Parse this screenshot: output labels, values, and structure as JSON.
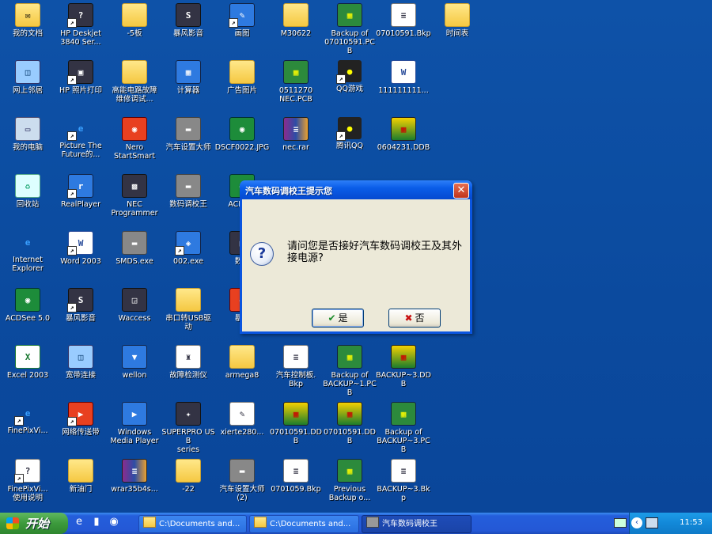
{
  "desktop": {
    "icons": [
      {
        "label": "我的文档",
        "type": "folder",
        "glyph": "✉"
      },
      {
        "label": "HP Deskjet\n3840 Ser...",
        "type": "app",
        "glyph": "?",
        "shortcut": true
      },
      {
        "label": "-5板",
        "type": "folder",
        "glyph": ""
      },
      {
        "label": "暴风影音",
        "type": "app",
        "glyph": "S"
      },
      {
        "label": "画图",
        "type": "blue",
        "glyph": "✎",
        "shortcut": true
      },
      {
        "label": "M30622",
        "type": "folder",
        "glyph": ""
      },
      {
        "label": "Backup of\n07010591.PCB",
        "type": "pcb",
        "glyph": "▦"
      },
      {
        "label": "07010591.Bkp",
        "type": "doc",
        "glyph": "≡"
      },
      {
        "label": "时间表",
        "type": "folder",
        "glyph": ""
      },
      {
        "label": "网上邻居",
        "type": "net",
        "glyph": "◫"
      },
      {
        "label": "HP 照片打印",
        "type": "app",
        "glyph": "▣",
        "shortcut": true
      },
      {
        "label": "高能电路故障\n维修调试...",
        "type": "folder",
        "glyph": ""
      },
      {
        "label": "计算器",
        "type": "blue",
        "glyph": "▦"
      },
      {
        "label": "广告图片",
        "type": "folder",
        "glyph": ""
      },
      {
        "label": "0511270\nNEC.PCB",
        "type": "pcb",
        "glyph": "▦"
      },
      {
        "label": "QQ游戏",
        "type": "qq",
        "glyph": "●",
        "shortcut": true
      },
      {
        "label": "111111111...",
        "type": "word",
        "glyph": "W"
      },
      {
        "label": "我的电脑",
        "type": "pc",
        "glyph": "▭"
      },
      {
        "label": "Picture The\nFuture的...",
        "type": "ie",
        "glyph": "e",
        "shortcut": true
      },
      {
        "label": "Nero\nStartSmart",
        "type": "red",
        "glyph": "◉"
      },
      {
        "label": "汽车设置大师",
        "type": "chip",
        "glyph": "▬"
      },
      {
        "label": "DSCF0022.JPG",
        "type": "green",
        "glyph": "◉"
      },
      {
        "label": "nec.rar",
        "type": "rar",
        "glyph": "≡"
      },
      {
        "label": "腾讯QQ",
        "type": "qq",
        "glyph": "●",
        "shortcut": true
      },
      {
        "label": "0604231.DDB",
        "type": "ddb",
        "glyph": "▦"
      },
      {
        "label": "回收站",
        "type": "recycle",
        "glyph": "♻"
      },
      {
        "label": "RealPlayer",
        "type": "blue",
        "glyph": "r",
        "shortcut": true
      },
      {
        "label": "NEC\nProgrammer",
        "type": "app",
        "glyph": "▩"
      },
      {
        "label": "数码调校王",
        "type": "chip",
        "glyph": "▬"
      },
      {
        "label": "ACDS...",
        "type": "green",
        "glyph": "◉"
      },
      {
        "label": "Internet\nExplorer",
        "type": "ie",
        "glyph": "e"
      },
      {
        "label": "Word 2003",
        "type": "word",
        "glyph": "W",
        "shortcut": true
      },
      {
        "label": "SMDS.exe",
        "type": "chip",
        "glyph": "▬"
      },
      {
        "label": "002.exe",
        "type": "blue",
        "glyph": "◈",
        "shortcut": true
      },
      {
        "label": "数...",
        "type": "app",
        "glyph": "▣"
      },
      {
        "label": "ACDSee 5.0",
        "type": "green",
        "glyph": "◉"
      },
      {
        "label": "暴风影音",
        "type": "app",
        "glyph": "S",
        "shortcut": true
      },
      {
        "label": "Waccess",
        "type": "app",
        "glyph": "◲"
      },
      {
        "label": "串口转USB驱\n动",
        "type": "folder",
        "glyph": ""
      },
      {
        "label": "暴...",
        "type": "red",
        "glyph": "◐"
      },
      {
        "label": "Excel 2003",
        "type": "excel",
        "glyph": "X"
      },
      {
        "label": "宽带连接",
        "type": "net",
        "glyph": "◫"
      },
      {
        "label": "wellon",
        "type": "blue",
        "glyph": "▼"
      },
      {
        "label": "故障检测仪",
        "type": "doc",
        "glyph": "♜"
      },
      {
        "label": "armega8",
        "type": "folder",
        "glyph": ""
      },
      {
        "label": "汽车控制板.\nBkp",
        "type": "doc",
        "glyph": "≡"
      },
      {
        "label": "Backup of\nBACKUP~1.PCB",
        "type": "pcb",
        "glyph": "▦"
      },
      {
        "label": "BACKUP~3.DDB",
        "type": "ddb",
        "glyph": "▦"
      },
      {
        "label": "FinePixVi...",
        "type": "ie",
        "glyph": "e",
        "shortcut": true
      },
      {
        "label": "网络传送带",
        "type": "red",
        "glyph": "▶",
        "shortcut": true
      },
      {
        "label": "Windows\nMedia Player",
        "type": "blue",
        "glyph": "▶"
      },
      {
        "label": "SUPERPRO USB\nseries",
        "type": "app",
        "glyph": "✦"
      },
      {
        "label": "xierte280...",
        "type": "doc",
        "glyph": "✎"
      },
      {
        "label": "07010591.DDB",
        "type": "ddb",
        "glyph": "▦"
      },
      {
        "label": "07010591.DDB",
        "type": "ddb",
        "glyph": "▦"
      },
      {
        "label": "Backup of\nBACKUP~3.PCB",
        "type": "pcb",
        "glyph": "▦"
      },
      {
        "label": "FinePixVi...\n使用说明",
        "type": "doc",
        "glyph": "?",
        "shortcut": true
      },
      {
        "label": "新油门",
        "type": "folder",
        "glyph": ""
      },
      {
        "label": "wrar35b4s...",
        "type": "rar",
        "glyph": "≡"
      },
      {
        "label": "-22",
        "type": "folder",
        "glyph": ""
      },
      {
        "label": "汽车设置大师\n(2)",
        "type": "chip",
        "glyph": "▬"
      },
      {
        "label": "0701059.Bkp",
        "type": "doc",
        "glyph": "≡"
      },
      {
        "label": "Previous\nBackup o...",
        "type": "pcb",
        "glyph": "▦"
      },
      {
        "label": "BACKUP~3.Bkp",
        "type": "doc",
        "glyph": "≡"
      }
    ]
  },
  "dialog": {
    "title": "汽车数码调校王提示您",
    "close_glyph": "✕",
    "question_glyph": "?",
    "message": "请问您是否接好汽车数码调校王及其外接电源?",
    "yes_icon": "✔",
    "yes_label": "是",
    "no_icon": "✖",
    "no_label": "否"
  },
  "taskbar": {
    "start_label": "开始",
    "quicklaunch": [
      "e",
      "▮",
      "◉"
    ],
    "tasks": [
      {
        "label": "C:\\Documents and...",
        "icon": "folder",
        "active": false
      },
      {
        "label": "C:\\Documents and...",
        "icon": "folder",
        "active": false
      },
      {
        "label": "汽车数码调校王",
        "icon": "chip",
        "active": true
      }
    ],
    "tray_arrow": "‹",
    "clock": "11:53"
  }
}
